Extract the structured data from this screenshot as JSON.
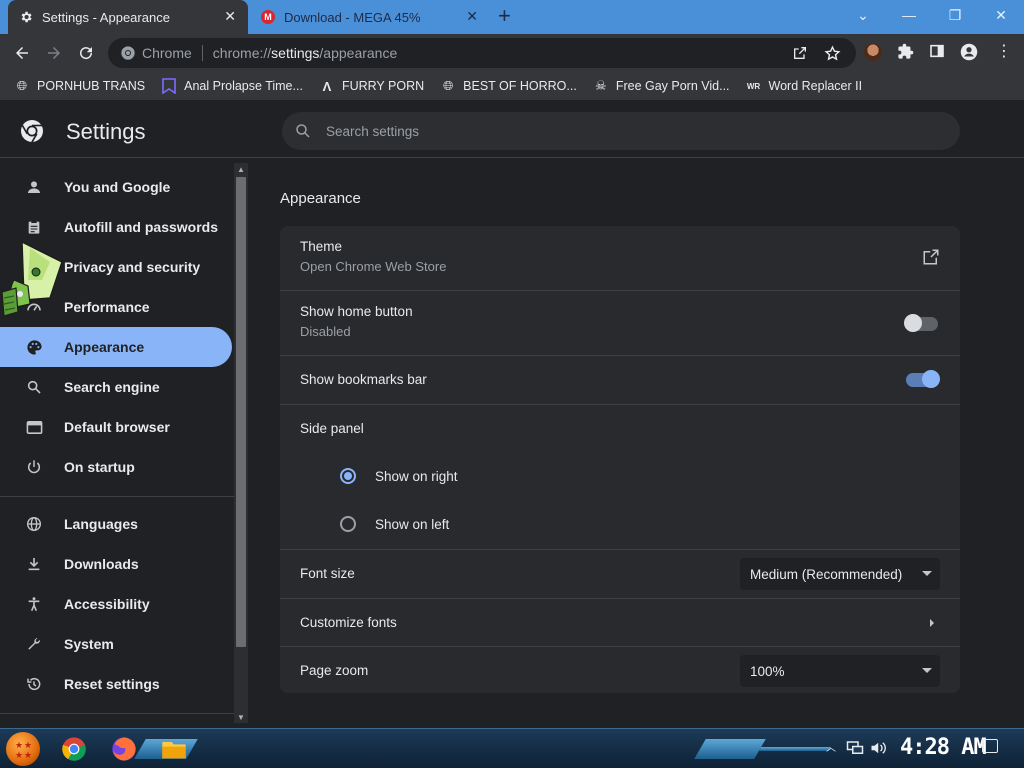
{
  "tabs": [
    {
      "label": "Settings - Appearance",
      "icon": "gear-icon",
      "active": true
    },
    {
      "label": "Download - MEGA 45%",
      "icon": "mega-icon",
      "active": false
    }
  ],
  "mega_badge": "M",
  "window_controls": {
    "minimize": "—",
    "maximize": "❐",
    "close": "✕",
    "dropdown": "⌄"
  },
  "toolbar": {
    "omnibox_label": "Chrome",
    "url_prefix": "chrome://",
    "url_bold": "settings",
    "url_suffix": "/appearance"
  },
  "bookmarks": [
    {
      "label": "PORNHUB TRANS",
      "icon": "globe-icon"
    },
    {
      "label": "Anal Prolapse Time...",
      "icon": "bookmark-icon"
    },
    {
      "label": "FURRY PORN",
      "icon": "lambda-icon"
    },
    {
      "label": "BEST OF HORRO...",
      "icon": "globe-icon"
    },
    {
      "label": "Free Gay Porn Vid...",
      "icon": "skull-icon"
    },
    {
      "label": "Word Replacer II",
      "icon": "wr-icon"
    }
  ],
  "settings": {
    "title": "Settings",
    "search_placeholder": "Search settings"
  },
  "sidebar": {
    "items": [
      {
        "label": "You and Google",
        "icon": "person-icon",
        "active": false
      },
      {
        "label": "Autofill and passwords",
        "icon": "clipboard-icon",
        "active": false
      },
      {
        "label": "Privacy and security",
        "icon": "shield-icon",
        "active": false
      },
      {
        "label": "Performance",
        "icon": "speedometer-icon",
        "active": false
      },
      {
        "label": "Appearance",
        "icon": "palette-icon",
        "active": true
      },
      {
        "label": "Search engine",
        "icon": "search-icon",
        "active": false
      },
      {
        "label": "Default browser",
        "icon": "browser-icon",
        "active": false
      },
      {
        "label": "On startup",
        "icon": "power-icon",
        "active": false
      },
      {
        "label": "Languages",
        "icon": "globe-icon",
        "active": false
      },
      {
        "label": "Downloads",
        "icon": "download-icon",
        "active": false
      },
      {
        "label": "Accessibility",
        "icon": "accessibility-icon",
        "active": false
      },
      {
        "label": "System",
        "icon": "wrench-icon",
        "active": false
      },
      {
        "label": "Reset settings",
        "icon": "history-icon",
        "active": false
      }
    ]
  },
  "main": {
    "section_title": "Appearance",
    "theme": {
      "label": "Theme",
      "sub": "Open Chrome Web Store"
    },
    "home_button": {
      "label": "Show home button",
      "sub": "Disabled",
      "enabled": false
    },
    "bookmarks_bar": {
      "label": "Show bookmarks bar",
      "enabled": true
    },
    "side_panel": {
      "label": "Side panel",
      "options": [
        "Show on right",
        "Show on left"
      ],
      "selected": "Show on right"
    },
    "font_size": {
      "label": "Font size",
      "value": "Medium (Recommended)"
    },
    "customize_fonts": {
      "label": "Customize fonts"
    },
    "page_zoom": {
      "label": "Page zoom",
      "value": "100%"
    }
  },
  "taskbar": {
    "clock": "4:28 AM"
  },
  "colors": {
    "accent": "#8ab4f8",
    "tabstrip": "#4a90d9",
    "background": "#202124",
    "card": "#292a2d"
  }
}
